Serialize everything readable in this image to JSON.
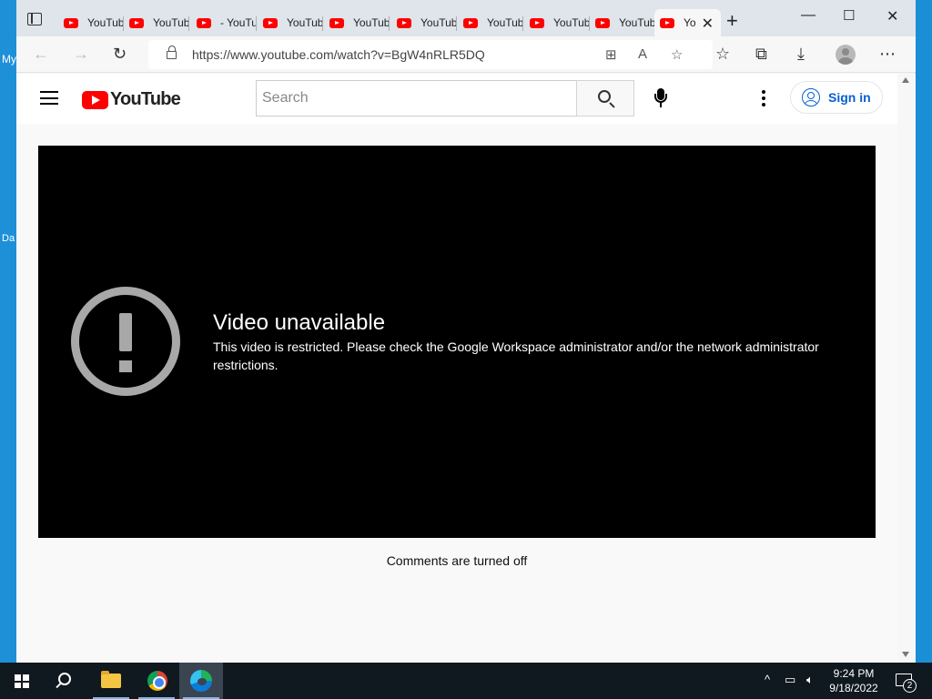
{
  "desktop": {
    "icon_labels": [
      "My",
      "Da"
    ]
  },
  "browser": {
    "tabs": [
      {
        "label": "YouTube"
      },
      {
        "label": "YouTube"
      },
      {
        "label": "- YouTube"
      },
      {
        "label": "YouTube"
      },
      {
        "label": "YouTube"
      },
      {
        "label": "YouTube"
      },
      {
        "label": "YouTube"
      },
      {
        "label": "YouTube"
      },
      {
        "label": "YouTube"
      },
      {
        "label": "Yo",
        "active": true
      }
    ],
    "new_tab_label": "+",
    "window_controls": {
      "minimize": "—",
      "maximize": "☐",
      "close": "✕"
    },
    "address_bar": {
      "url": "https://www.youtube.com/watch?v=BgW4nRLR5DQ"
    },
    "toolbar_icons": [
      "back-icon",
      "forward-icon",
      "refresh-icon",
      "apps-icon",
      "read-aloud-icon",
      "add-favorite-icon",
      "favorites-icon",
      "collections-icon",
      "downloads-icon",
      "profile-icon",
      "more-icon"
    ]
  },
  "youtube": {
    "logo_text": "YouTube",
    "search": {
      "placeholder": "Search",
      "value": ""
    },
    "sign_in_label": "Sign in",
    "player": {
      "error_title": "Video unavailable",
      "error_message": "This video is restricted. Please check the Google Workspace administrator and/or the network administrator restrictions."
    },
    "comments_status": "Comments are turned off"
  },
  "taskbar": {
    "time": "9:24 PM",
    "date": "9/18/2022",
    "notification_count": "2",
    "apps": [
      "file-explorer-icon",
      "chrome-icon",
      "edge-icon"
    ]
  }
}
